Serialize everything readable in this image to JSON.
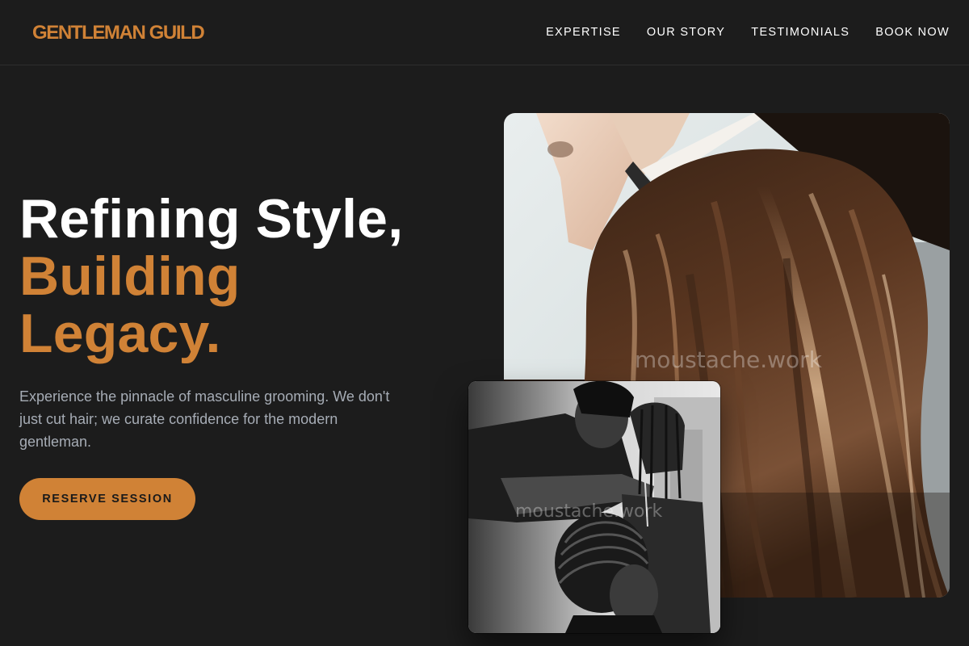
{
  "brand": {
    "name": "GENTLEMAN GUILD",
    "accent_color": "#d08236",
    "background_color": "#1c1c1c"
  },
  "nav": {
    "items": [
      {
        "label": "EXPERTISE"
      },
      {
        "label": "OUR STORY"
      },
      {
        "label": "TESTIMONIALS"
      },
      {
        "label": "BOOK NOW"
      }
    ]
  },
  "hero": {
    "title_line1": "Refining Style,",
    "title_line2": "Building",
    "title_line3": "Legacy.",
    "subtitle": "Experience the pinnacle of masculine grooming. We don't just cut hair; we curate confidence for the modern gentleman.",
    "cta_label": "RESERVE SESSION"
  },
  "images": {
    "main": {
      "watermark": "moustache.work",
      "subject": "stylist curling long brown hair"
    },
    "secondary": {
      "watermark": "moustache.work",
      "subject": "black and white photo of braiders working on cornrows"
    }
  }
}
